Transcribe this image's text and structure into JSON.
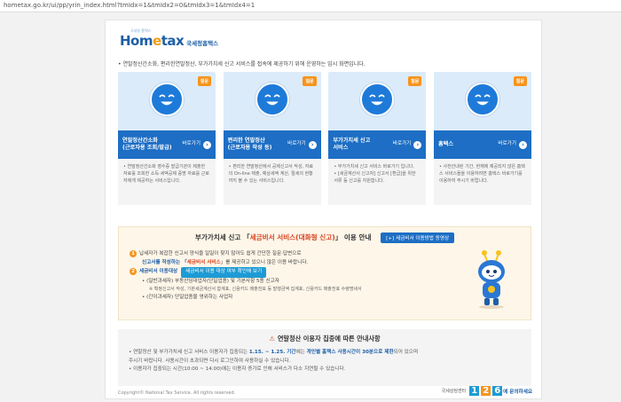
{
  "url": "hometax.go.kr/ui/pp/yrin_index.html?tmIdx=1&tmIdx2=0&tmIdx3=1&tmIdx4=1",
  "logo": {
    "brand_left": "Hom",
    "brand_accent": "e",
    "brand_right": "tax",
    "subtitle": "국세청홈택스",
    "tagline": "국세청 홈택스"
  },
  "notice": "• 연말정산간소화, 편리한연말정산, 부가가치세 신고 서비스를 접속에 제공하기 위해 운영하는 임시 화면입니다.",
  "cards": [
    {
      "tag": "질문",
      "title_line1": "연말정산간소화",
      "title_line2": "(근로자용 조회/발급)",
      "go": "바로가기",
      "desc": "• 연말정산간소화 영수증 발급기관이 제출한 자료를 조회한 소득·세액공제 증명 자료를 근로자에게 제공하는 서비스입니다."
    },
    {
      "tag": "질문",
      "title_line1": "편리한 연말정산",
      "title_line2": "(근로자용 작성 등)",
      "go": "바로가기",
      "desc": "• 편리한 연말정산에서 공제신고서 작성, 자료의 On-line 제출, 예상세액 계산, 절세의 현황까지 볼 수 있는 서비스입니다."
    },
    {
      "tag": "질문",
      "title_line1": "부가가치세 신고",
      "title_line2": "서비스",
      "go": "바로가기",
      "desc": "• 부가가치세 신고 서비스 바로가기 입니다.\n• [세금계산서 신고자] 신고서 [환급]을 위한 서류 등 신고를 지원합니다."
    },
    {
      "tag": "질문",
      "title_line1": "홈택스",
      "title_line2": "",
      "go": "바로가기",
      "desc": "• 사전안내된 기간, 현재에 제공되지 않은 홈택스 서비스들을 이용하려면 홈택스 바로가기를 이용하여 주시기 바랍니다."
    }
  ],
  "vat": {
    "head_prefix": "부가가치세 신고 「",
    "head_em": "세금비서 서비스(대화형 신고)",
    "head_suffix": "」 이용 안내",
    "guide_button": "[+] 세금비서 이용방법 동영상",
    "line1": "납세자가 복잡한 신고서 양식을 일일이 찾지 않아도 쉽게 간단한 질문·답변으로",
    "line1b_prefix": "신고서를 작성하는 「",
    "line1b_em": "세금비서 서비스",
    "line1b_suffix": "」를 제공하고 있으니 많은 이용 바랍니다.",
    "line2_label": "세금비서 이용대상",
    "target_button": "세금비서 이용 대상 여부 확인해 보기",
    "sub1": "• (일반과세자) 부동산임대업자(단일업종) 및 기본사항 5종 신고자",
    "sub2": "※ 확정신고서 작성, 기본세금계산서 합계표, 신용카드 매출전표 등 발행금액 집계표, 신용카드 매출전표 수령명세서",
    "sub3": "• (간이과세자) 단일업종을 영위하는 사업자"
  },
  "year": {
    "icon": "⚠",
    "head": "연말정산 이용자 집중에 따른 안내사항",
    "line1_prefix": "• 연말정산 및 부가가치세 신고 서비스 이용자가 집중되는",
    "line1_em": "1.15. ~ 1.25. 기간",
    "line1_mid": "에는",
    "line1_em2": "개인별 홈택스 사용시간이 30분으로 제한",
    "line1_suffix": "되어 있으며",
    "line1b": "  주시기 바랍니다. 사용시간이 초과되면 다시 로그인하여 사용하실 수 있습니다.",
    "line2": "• 이용자가 집중되는 시간(10:00 ~ 14:00)에는 이용자 증가로 인해 서비스가 다소 지연될 수 있습니다."
  },
  "footer": "Copyright© National Tax Service. All rights reserved.",
  "callcenter": {
    "pre": "국세상담센터",
    "d1": "1",
    "d2": "2",
    "d3": "6",
    "suffix": "에 문의하세요"
  },
  "colors": {
    "primary": "#1d6ec4",
    "accent": "#f7941d",
    "highlight": "#d9411e"
  }
}
